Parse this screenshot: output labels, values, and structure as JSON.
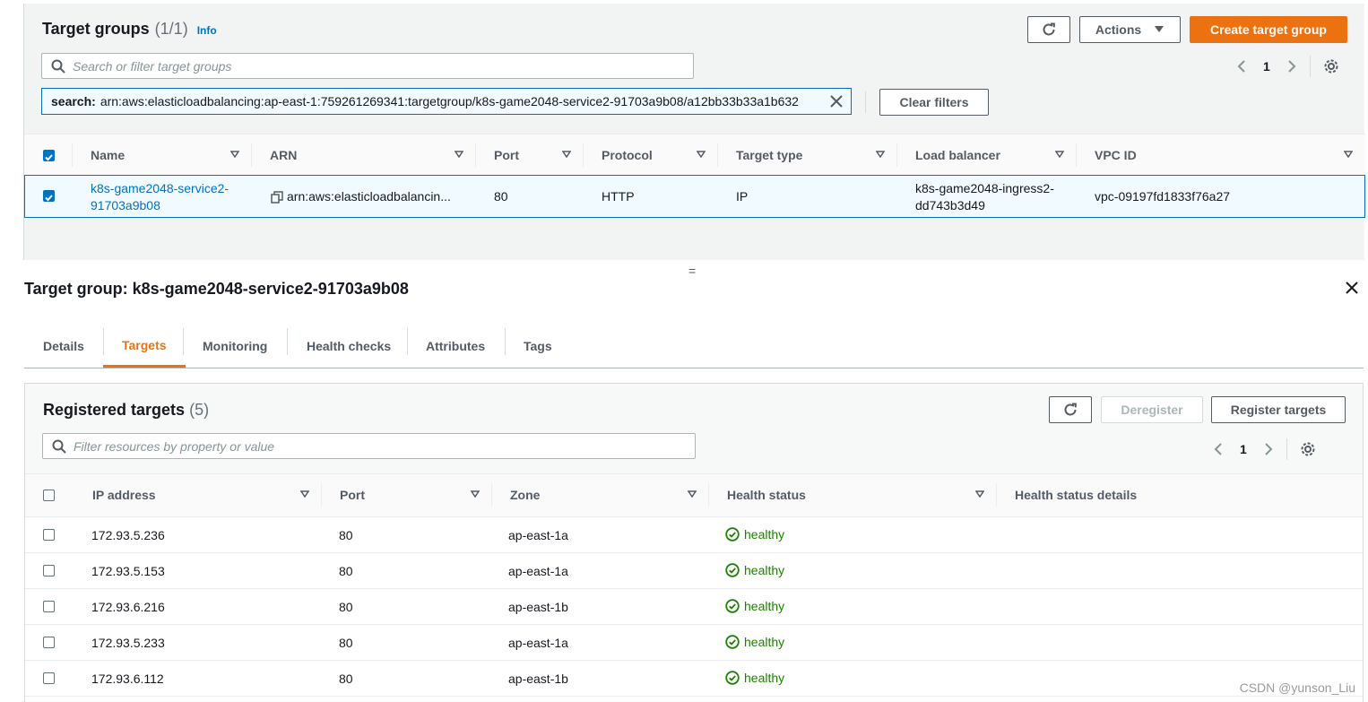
{
  "target_groups": {
    "title": "Target groups",
    "count": "(1/1)",
    "info_label": "Info",
    "refresh_icon": "refresh-icon",
    "actions_label": "Actions",
    "create_label": "Create target group",
    "search_placeholder": "Search or filter target groups",
    "page": "1",
    "filter_token_key": "search:",
    "filter_token_value": "arn:aws:elasticloadbalancing:ap-east-1:759261269341:targetgroup/k8s-game2048-service2-91703a9b08/a12bb33b33a1b632",
    "clear_filters_label": "Clear filters",
    "columns": [
      "Name",
      "ARN",
      "Port",
      "Protocol",
      "Target type",
      "Load balancer",
      "VPC ID"
    ],
    "row": {
      "name_line1": "k8s-game2048-service2-",
      "name_line2": "91703a9b08",
      "arn": "arn:aws:elasticloadbalancin...",
      "port": "80",
      "protocol": "HTTP",
      "target_type": "IP",
      "load_balancer_line1": "k8s-game2048-ingress2-",
      "load_balancer_line2": "dd743b3d49",
      "vpc_id": "vpc-09197fd1833f76a27"
    }
  },
  "splitter_glyph": "=",
  "detail": {
    "title": "Target group: k8s-game2048-service2-91703a9b08",
    "tabs": [
      "Details",
      "Targets",
      "Monitoring",
      "Health checks",
      "Attributes",
      "Tags"
    ],
    "active_tab": "Targets"
  },
  "registered_targets": {
    "title": "Registered targets",
    "count": "(5)",
    "deregister_label": "Deregister",
    "register_label": "Register targets",
    "filter_placeholder": "Filter resources by property or value",
    "page": "1",
    "columns": [
      "IP address",
      "Port",
      "Zone",
      "Health status",
      "Health status details"
    ],
    "rows": [
      {
        "ip": "172.93.5.236",
        "port": "80",
        "zone": "ap-east-1a",
        "health": "healthy",
        "details": ""
      },
      {
        "ip": "172.93.5.153",
        "port": "80",
        "zone": "ap-east-1a",
        "health": "healthy",
        "details": ""
      },
      {
        "ip": "172.93.6.216",
        "port": "80",
        "zone": "ap-east-1b",
        "health": "healthy",
        "details": ""
      },
      {
        "ip": "172.93.5.233",
        "port": "80",
        "zone": "ap-east-1a",
        "health": "healthy",
        "details": ""
      },
      {
        "ip": "172.93.6.112",
        "port": "80",
        "zone": "ap-east-1b",
        "health": "healthy",
        "details": ""
      }
    ]
  },
  "colors": {
    "accent_orange": "#ec7211",
    "link_blue": "#0073bb",
    "healthy_green": "#1d8102"
  },
  "watermark": "CSDN @yunson_Liu"
}
